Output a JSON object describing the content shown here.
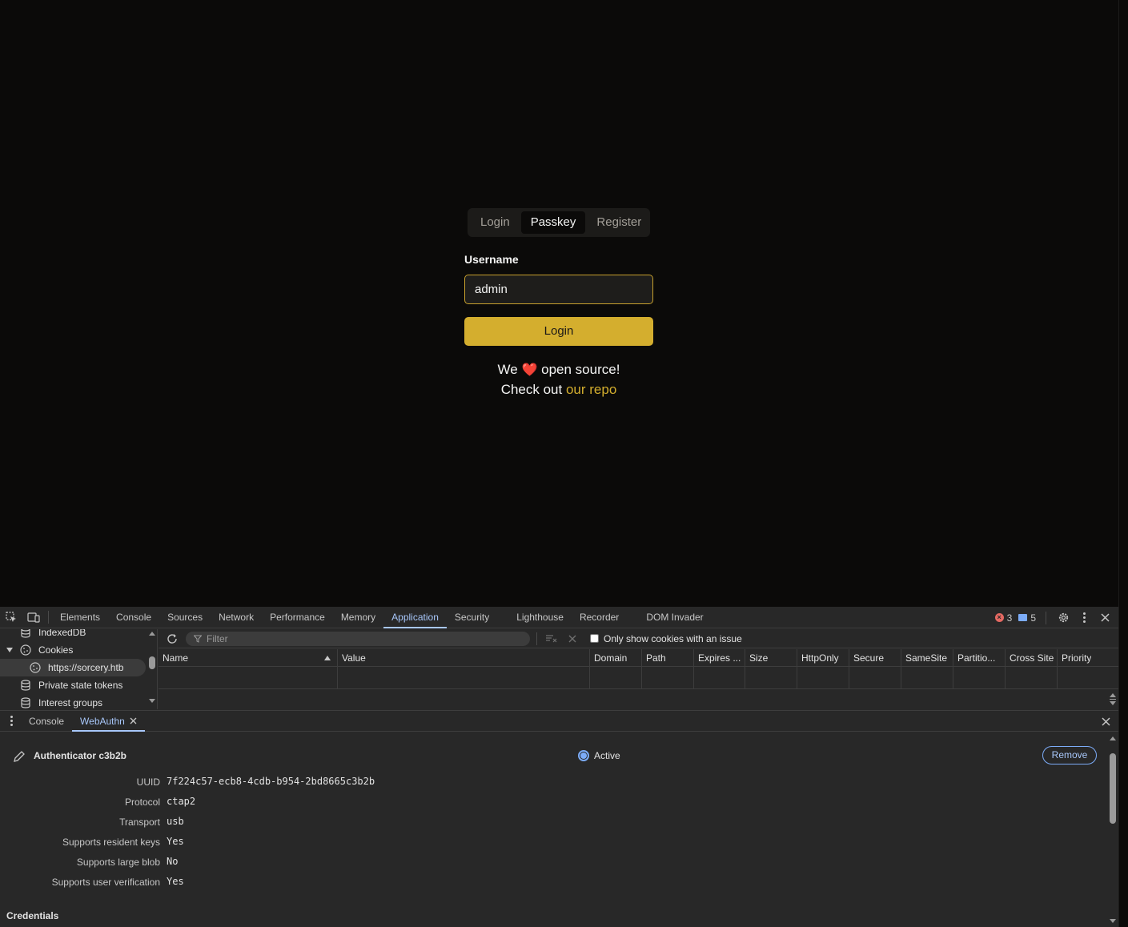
{
  "site": {
    "tabs": [
      {
        "label": "Login"
      },
      {
        "label": "Passkey"
      },
      {
        "label": "Register"
      }
    ],
    "username_label": "Username",
    "username_value": "admin",
    "login_button": "Login",
    "footer_line1_before": "We",
    "footer_heart": "❤️",
    "footer_line1_after": "open source!",
    "footer_line2_prefix": "Check out",
    "footer_link": "our repo",
    "accent_color": "#d4ae2e"
  },
  "devtools": {
    "panel_tabs": [
      "Elements",
      "Console",
      "Sources",
      "Network",
      "Performance",
      "Memory",
      "Application",
      "Security",
      "Lighthouse",
      "Recorder",
      "DOM Invader"
    ],
    "active_panel": "Application",
    "error_count": "3",
    "message_count": "5",
    "sidebar": {
      "items": [
        {
          "label": "IndexedDB",
          "icon": "database-icon"
        },
        {
          "label": "Cookies",
          "icon": "cookie-icon"
        },
        {
          "label": "https://sorcery.htb",
          "icon": "cookie-icon"
        },
        {
          "label": "Private state tokens",
          "icon": "database-icon"
        },
        {
          "label": "Interest groups",
          "icon": "database-icon"
        }
      ]
    },
    "cookies": {
      "filter_placeholder": "Filter",
      "only_issue_label": "Only show cookies with an issue",
      "columns": [
        "Name",
        "Value",
        "Domain",
        "Path",
        "Expires ...",
        "Size",
        "HttpOnly",
        "Secure",
        "SameSite",
        "Partitio...",
        "Cross Site",
        "Priority"
      ]
    },
    "drawer": {
      "tabs": [
        "Console",
        "WebAuthn"
      ],
      "active_tab": "WebAuthn"
    },
    "webauthn": {
      "authenticator_title": "Authenticator c3b2b",
      "active_label": "Active",
      "remove_label": "Remove",
      "fields": [
        {
          "key": "UUID",
          "value": "7f224c57-ecb8-4cdb-b954-2bd8665c3b2b"
        },
        {
          "key": "Protocol",
          "value": "ctap2"
        },
        {
          "key": "Transport",
          "value": "usb"
        },
        {
          "key": "Supports resident keys",
          "value": "Yes"
        },
        {
          "key": "Supports large blob",
          "value": "No"
        },
        {
          "key": "Supports user verification",
          "value": "Yes"
        }
      ],
      "credentials_title": "Credentials"
    }
  }
}
